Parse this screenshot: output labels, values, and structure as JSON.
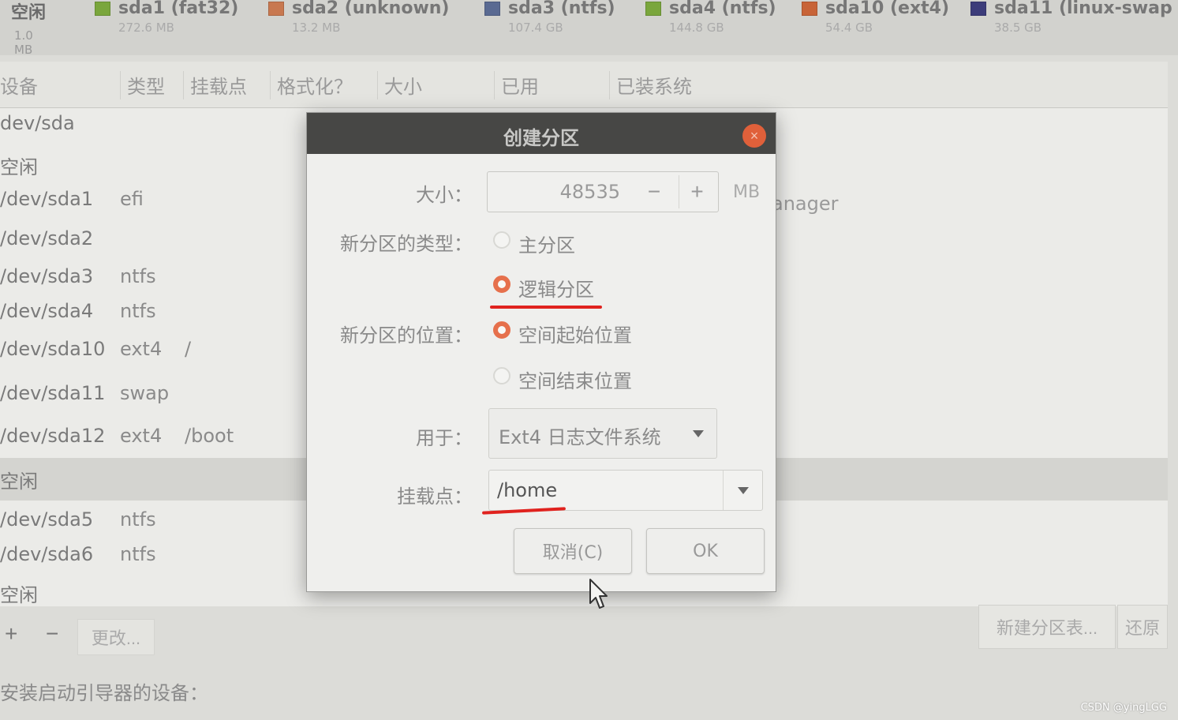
{
  "partition_bar": {
    "free": {
      "name": "空闲",
      "size": "1.0 MB"
    },
    "partitions": [
      {
        "name": "sda1 (fat32)",
        "size": "272.6 MB",
        "color": "#7aa63c"
      },
      {
        "name": "sda2 (unknown)",
        "size": "13.2 MB",
        "color": "#c87850"
      },
      {
        "name": "sda3 (ntfs)",
        "size": "107.4 GB",
        "color": "#5a6a92"
      },
      {
        "name": "sda4 (ntfs)",
        "size": "144.8 GB",
        "color": "#7aa63c"
      },
      {
        "name": "sda10 (ext4)",
        "size": "54.4 GB",
        "color": "#c86438"
      },
      {
        "name": "sda11 (linux-swap",
        "size": "38.5 GB",
        "color": "#3c3c7a"
      }
    ]
  },
  "table": {
    "headers": [
      "设备",
      "类型",
      "挂载点",
      "格式化？",
      "大小",
      "已用",
      "已装系统"
    ],
    "rows": [
      {
        "device": "dev/sda",
        "type": "",
        "mount": ""
      },
      {
        "device": "空闲",
        "type": "",
        "mount": ""
      },
      {
        "device": "/dev/sda1",
        "type": "efi",
        "mount": ""
      },
      {
        "device": "/dev/sda2",
        "type": "",
        "mount": ""
      },
      {
        "device": "/dev/sda3",
        "type": "ntfs",
        "mount": ""
      },
      {
        "device": "/dev/sda4",
        "type": "ntfs",
        "mount": ""
      },
      {
        "device": "/dev/sda10",
        "type": "ext4",
        "mount": "/"
      },
      {
        "device": "/dev/sda11",
        "type": "swap",
        "mount": ""
      },
      {
        "device": "/dev/sda12",
        "type": "ext4",
        "mount": "/boot"
      },
      {
        "device": "空闲",
        "type": "",
        "mount": ""
      },
      {
        "device": "/dev/sda5",
        "type": "ntfs",
        "mount": ""
      },
      {
        "device": "/dev/sda6",
        "type": "ntfs",
        "mount": ""
      },
      {
        "device": "空闲",
        "type": "",
        "mount": ""
      }
    ],
    "side_text": "anager"
  },
  "toolbar": {
    "add": "+",
    "remove": "−",
    "change": "更改...",
    "new_table": "新建分区表...",
    "revert": "还原"
  },
  "boot_label": "安装启动引导器的设备：",
  "dialog": {
    "title": "创建分区",
    "close": "×",
    "size_label": "大小：",
    "size_value": "48535",
    "size_minus": "−",
    "size_plus": "+",
    "size_unit": "MB",
    "type_label": "新分区的类型：",
    "type_primary": "主分区",
    "type_logical": "逻辑分区",
    "location_label": "新分区的位置：",
    "location_start": "空间起始位置",
    "location_end": "空间结束位置",
    "use_label": "用于：",
    "use_value": "Ext4 日志文件系统",
    "mount_label": "挂载点：",
    "mount_value": "/home",
    "cancel": "取消(C)",
    "ok": "OK",
    "highlight_color": "#e0221e"
  },
  "watermark": "CSDN @yingLGG"
}
